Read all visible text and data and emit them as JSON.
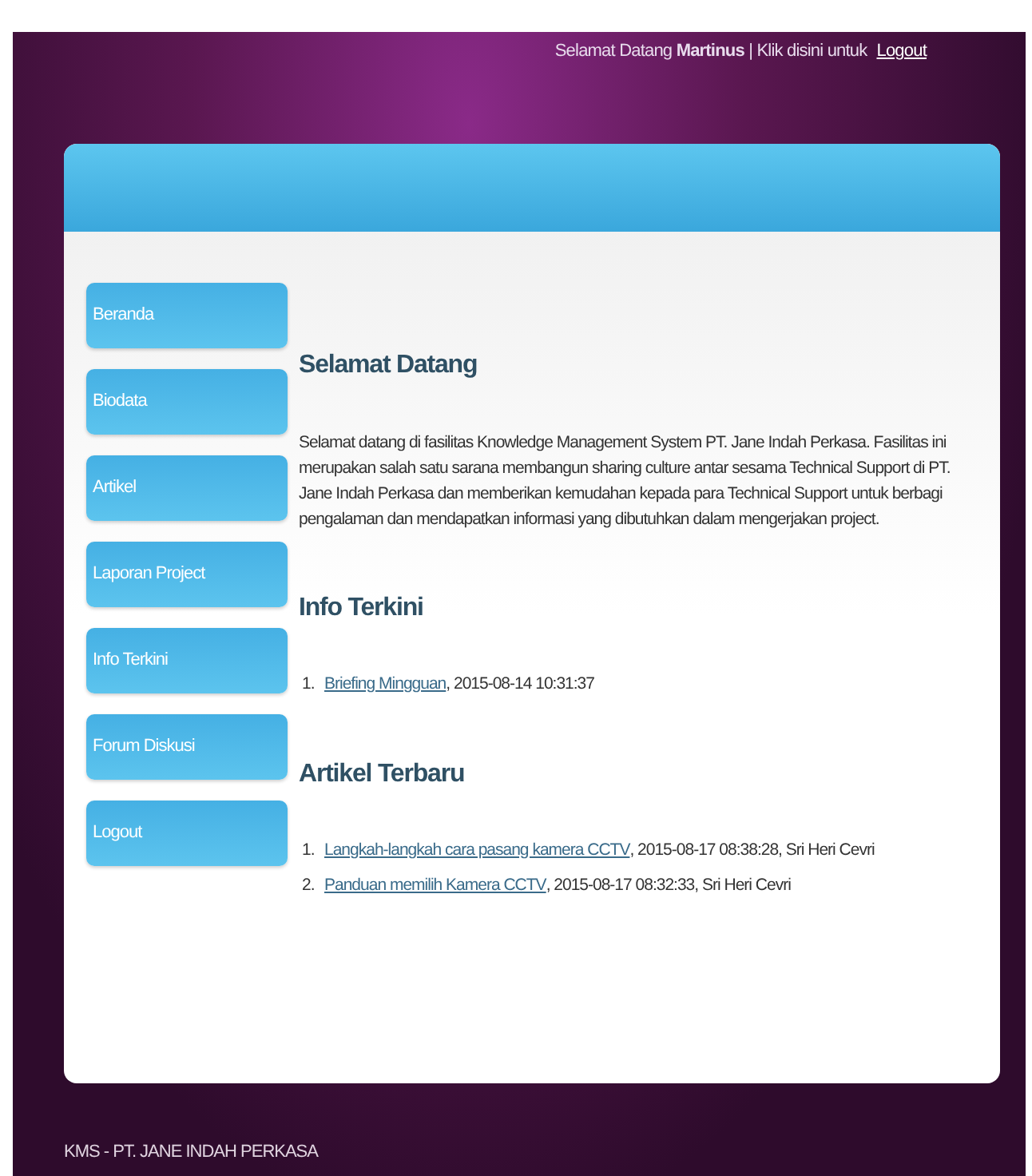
{
  "header": {
    "greeting": "Selamat Datang **Martinus** | Klik disini untuk",
    "logout_link": "Logout"
  },
  "sidebar": {
    "items": [
      {
        "label": "Beranda"
      },
      {
        "label": "Biodata"
      },
      {
        "label": "Artikel"
      },
      {
        "label": "Laporan Project"
      },
      {
        "label": "Info Terkini"
      },
      {
        "label": "Forum Diskusi"
      },
      {
        "label": "Logout"
      }
    ]
  },
  "content": {
    "sections": [
      {
        "title": "Selamat Datang",
        "paragraph": "Selamat datang di fasilitas Knowledge Management System PT. Jane Indah Perkasa. Fasilitas ini merupakan salah satu sarana membangun sharing culture antar sesama Technical Support di PT. Jane Indah Perkasa dan memberikan kemudahan kepada para Technical Support untuk berbagi pengalaman dan mendapatkan informasi yang dibutuhkan dalam mengerjakan project."
      },
      {
        "title": "Info Terkini",
        "items": [
          {
            "number": "1.",
            "link": "Briefing Mingguan",
            "details": ", 2015-08-14 10:31:37"
          }
        ]
      },
      {
        "title": "Artikel Terbaru",
        "items": [
          {
            "number": "1.",
            "link": "Langkah-langkah cara pasang kamera CCTV ",
            "details": ", 2015-08-17 08:38:28, Sri Heri Cevri"
          },
          {
            "number": "2.",
            "link": "Panduan memilih Kamera CCTV",
            "details": ", 2015-08-17 08:32:33, Sri Heri Cevri"
          }
        ]
      }
    ]
  },
  "footer": {
    "text": "KMS - PT. JANE INDAH PERKASA"
  }
}
